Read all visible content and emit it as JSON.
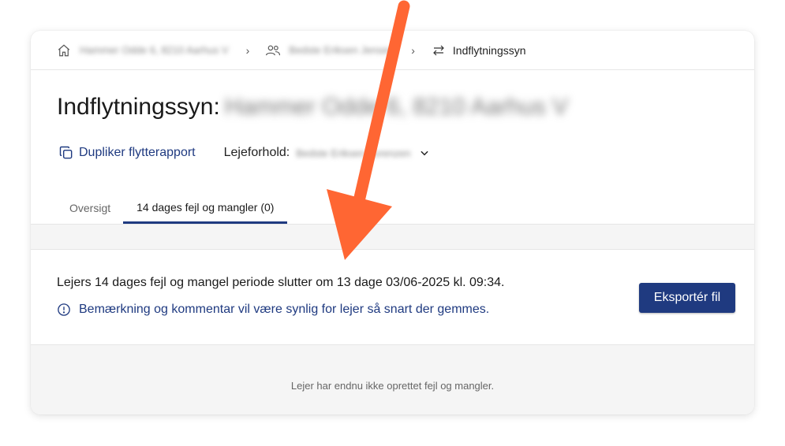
{
  "breadcrumb": {
    "item1": "Hammer Odde 6, 8210 Aarhus V",
    "item2": "Bedste Eriksen Jensen",
    "current": "Indflytningssyn"
  },
  "page": {
    "title_prefix": "Indflytningssyn:",
    "title_address": "Hammer Odde 6, 8210 Aarhus V"
  },
  "actions": {
    "duplicate_label": "Dupliker flytterapport",
    "lease_label": "Lejeforhold:",
    "lease_value": "Bedste Eriksen Lorenzen"
  },
  "tabs": [
    {
      "label": "Oversigt",
      "active": false
    },
    {
      "label": "14 dages fejl og mangler (0)",
      "active": true
    }
  ],
  "content": {
    "period_text": "Lejers 14 dages fejl og mangel periode slutter om 13 dage 03/06-2025 kl. 09:34.",
    "notice_text": "Bemærkning og kommentar vil være synlig for lejer så snart der gemmes.",
    "export_label": "Eksportér fil",
    "empty_text": "Lejer har endnu ikke oprettet fejl og mangler."
  },
  "colors": {
    "accent": "#1f3a80",
    "annotation_arrow": "#ff6633"
  }
}
